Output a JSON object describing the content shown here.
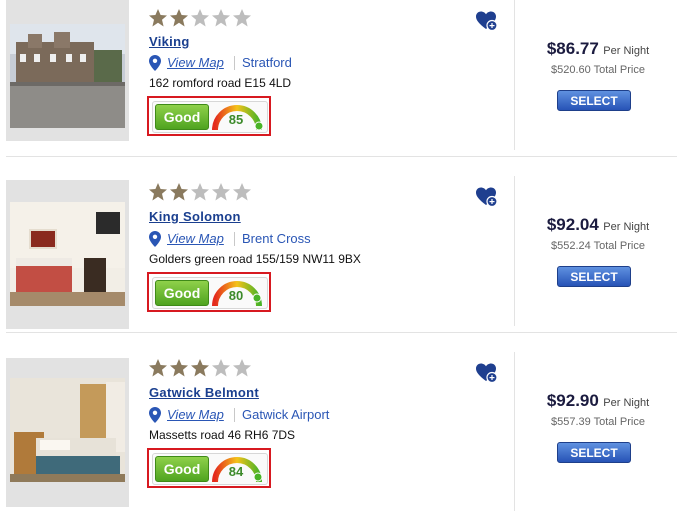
{
  "hotels": [
    {
      "name": "Viking",
      "stars": 2,
      "max_stars": 5,
      "view_map": "View Map",
      "area": "Stratford",
      "address": "162 romford road E15 4LD",
      "rating_label": "Good",
      "score": "85",
      "price": "$86.77",
      "per_night": "Per Night",
      "total": "$520.60",
      "total_label": "Total Price",
      "select": "SELECT"
    },
    {
      "name": "King Solomon",
      "stars": 2,
      "max_stars": 5,
      "view_map": "View Map",
      "area": "Brent Cross",
      "address": "Golders green road 155/159 NW11 9BX",
      "rating_label": "Good",
      "score": "80",
      "price": "$92.04",
      "per_night": "Per Night",
      "total": "$552.24",
      "total_label": "Total Price",
      "select": "SELECT"
    },
    {
      "name": "Gatwick Belmont",
      "stars": 3,
      "max_stars": 5,
      "view_map": "View Map",
      "area": "Gatwick Airport",
      "address": "Massetts road 46 RH6 7DS",
      "rating_label": "Good",
      "score": "84",
      "price": "$92.90",
      "per_night": "Per Night",
      "total": "$557.39",
      "total_label": "Total Price",
      "select": "SELECT"
    }
  ],
  "colors": {
    "star_filled": "#8a7a5e",
    "star_empty": "#bdbdbd",
    "accent_red": "#d71920",
    "link_blue": "#1a3f8f",
    "good_green": "#4fa320"
  },
  "icons": [
    "star-icon",
    "map-pin-icon",
    "favorite-heart-icon",
    "rating-gauge-icon"
  ]
}
